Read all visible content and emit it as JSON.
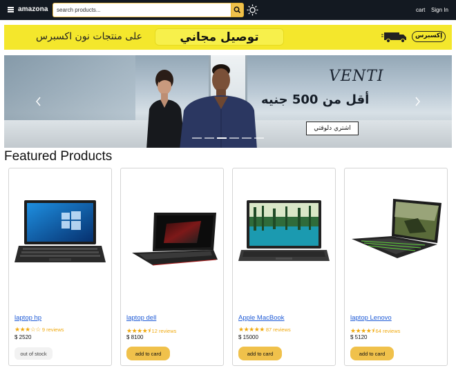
{
  "header": {
    "brand": "amazona",
    "search_placeholder": "search products...",
    "cart_label": "cart",
    "signin_label": "Sign In",
    "icons": [
      "menu-icon",
      "search-icon",
      "sun-icon"
    ]
  },
  "promo_banner": {
    "left_text": "على منتجات نون اكسبرس",
    "center_text": "توصيل مجاني",
    "logo_text": "إكسبرس",
    "colors": {
      "background": "#f4e72c"
    }
  },
  "hero": {
    "brand": "VENTI",
    "headline": "أقل من 500 جنيه",
    "cta": "اشتري دلوقتي",
    "slide_count": 6,
    "active_slide": 2
  },
  "section_title": "Featured Products",
  "products": [
    {
      "name": "laptop hp",
      "rating": 3,
      "reviews": "9 reviews",
      "price": "$ 2520",
      "action": "out of stock",
      "in_stock": false
    },
    {
      "name": "laptop dell",
      "rating": 4.5,
      "reviews": "12 reviews",
      "price": "$ 8100",
      "action": "add to card",
      "in_stock": true
    },
    {
      "name": "Apple MacBook",
      "rating": 5,
      "reviews": "87 reviews",
      "price": "$ 15000",
      "action": "add to card",
      "in_stock": true
    },
    {
      "name": "laptop Lenovo",
      "rating": 4.5,
      "reviews": "64 reviews",
      "price": "$ 5120",
      "action": "add to card",
      "in_stock": true
    }
  ],
  "colors": {
    "header_bg": "#131921",
    "accent": "#f0c14b",
    "link": "#1f5bd6",
    "star": "#f0a90e"
  }
}
